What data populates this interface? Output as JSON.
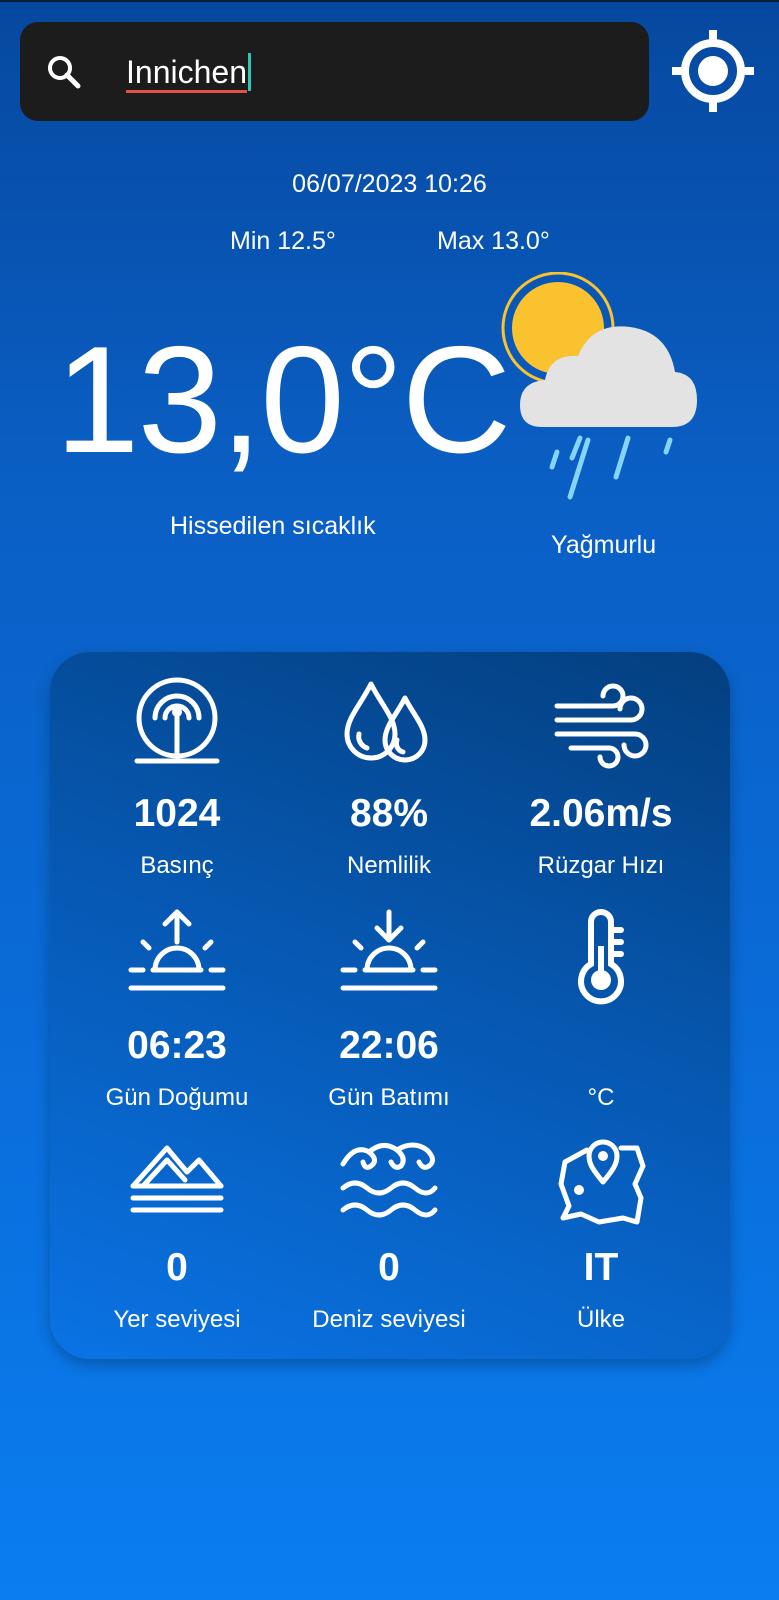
{
  "search": {
    "value": "Innichen"
  },
  "header": {
    "datetime": "06/07/2023 10:26",
    "min": "Min 12.5°",
    "max": "Max 13.0°"
  },
  "current": {
    "temperature": "13,0°C",
    "feels_label": "Hissedilen sıcaklık",
    "condition": "Yağmurlu"
  },
  "colors": {
    "sun": "#f9c22e",
    "cloud": "#e3e3e3",
    "rain": "#85d4f9",
    "search_bg": "#1c1c1c"
  },
  "stats": [
    {
      "icon": "pressure-icon",
      "value": "1024",
      "label": "Basınç"
    },
    {
      "icon": "humidity-icon",
      "value": "88%",
      "label": "Nemlilik"
    },
    {
      "icon": "wind-icon",
      "value": "2.06m/s",
      "label": "Rüzgar Hızı"
    },
    {
      "icon": "sunrise-icon",
      "value": "06:23",
      "label": "Gün Doğumu"
    },
    {
      "icon": "sunset-icon",
      "value": "22:06",
      "label": "Gün Batımı"
    },
    {
      "icon": "thermometer-icon",
      "value": "",
      "label": "°C"
    },
    {
      "icon": "mountain-icon",
      "value": "0",
      "label": "Yer seviyesi"
    },
    {
      "icon": "waves-icon",
      "value": "0",
      "label": "Deniz seviyesi"
    },
    {
      "icon": "map-pin-icon",
      "value": "IT",
      "label": "Ülke"
    }
  ]
}
